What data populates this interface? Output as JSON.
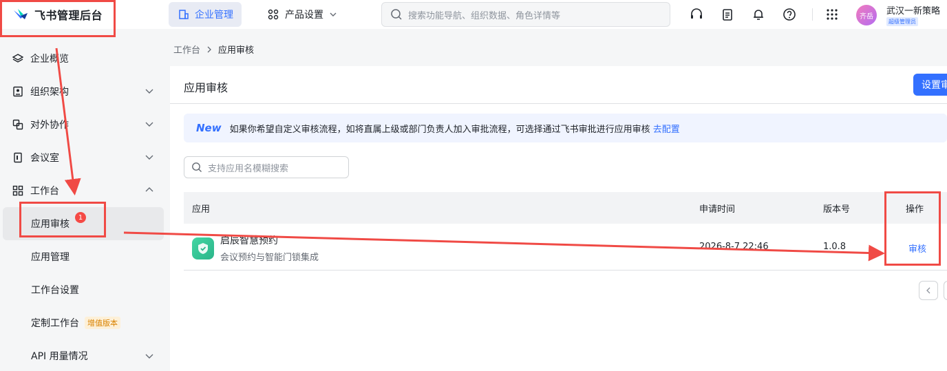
{
  "header": {
    "logo_title": "飞书管理后台",
    "nav_active": "企业管理",
    "nav_product": "产品设置",
    "search_placeholder": "搜索功能导航、组织数据、角色详情等",
    "org_name": "武汉一新策略",
    "avatar_text": "齐岳",
    "admin_badge": "超级管理员"
  },
  "sidebar": {
    "items": [
      {
        "label": "企业概览"
      },
      {
        "label": "组织架构"
      },
      {
        "label": "对外协作"
      },
      {
        "label": "会议室"
      },
      {
        "label": "工作台"
      }
    ],
    "sub_items": [
      {
        "label": "应用审核",
        "badge": "1"
      },
      {
        "label": "应用管理"
      },
      {
        "label": "工作台设置"
      },
      {
        "label": "定制工作台",
        "tag": "增值版本"
      },
      {
        "label": "API 用量情况"
      }
    ]
  },
  "breadcrumb": {
    "root": "工作台",
    "current": "应用审核"
  },
  "main": {
    "title": "应用审核",
    "settings_button": "设置审",
    "notice_new": "New",
    "notice_text": "如果你希望自定义审核流程，如将直属上级或部门负责人加入审批流程，可选择通过飞书审批进行应用审核",
    "notice_link": "去配置",
    "app_search_placeholder": "支持应用名模糊搜索",
    "table": {
      "headers": [
        "应用",
        "申请时间",
        "版本号",
        "操作"
      ],
      "rows": [
        {
          "name": "启辰智慧预约",
          "desc": "会议预约与智能门锁集成",
          "time": "2026-8-7 22:46",
          "version": "1.0.8",
          "action": "审核"
        }
      ]
    }
  },
  "colors": {
    "accent": "#3370ff",
    "annotation": "#f04a45"
  }
}
